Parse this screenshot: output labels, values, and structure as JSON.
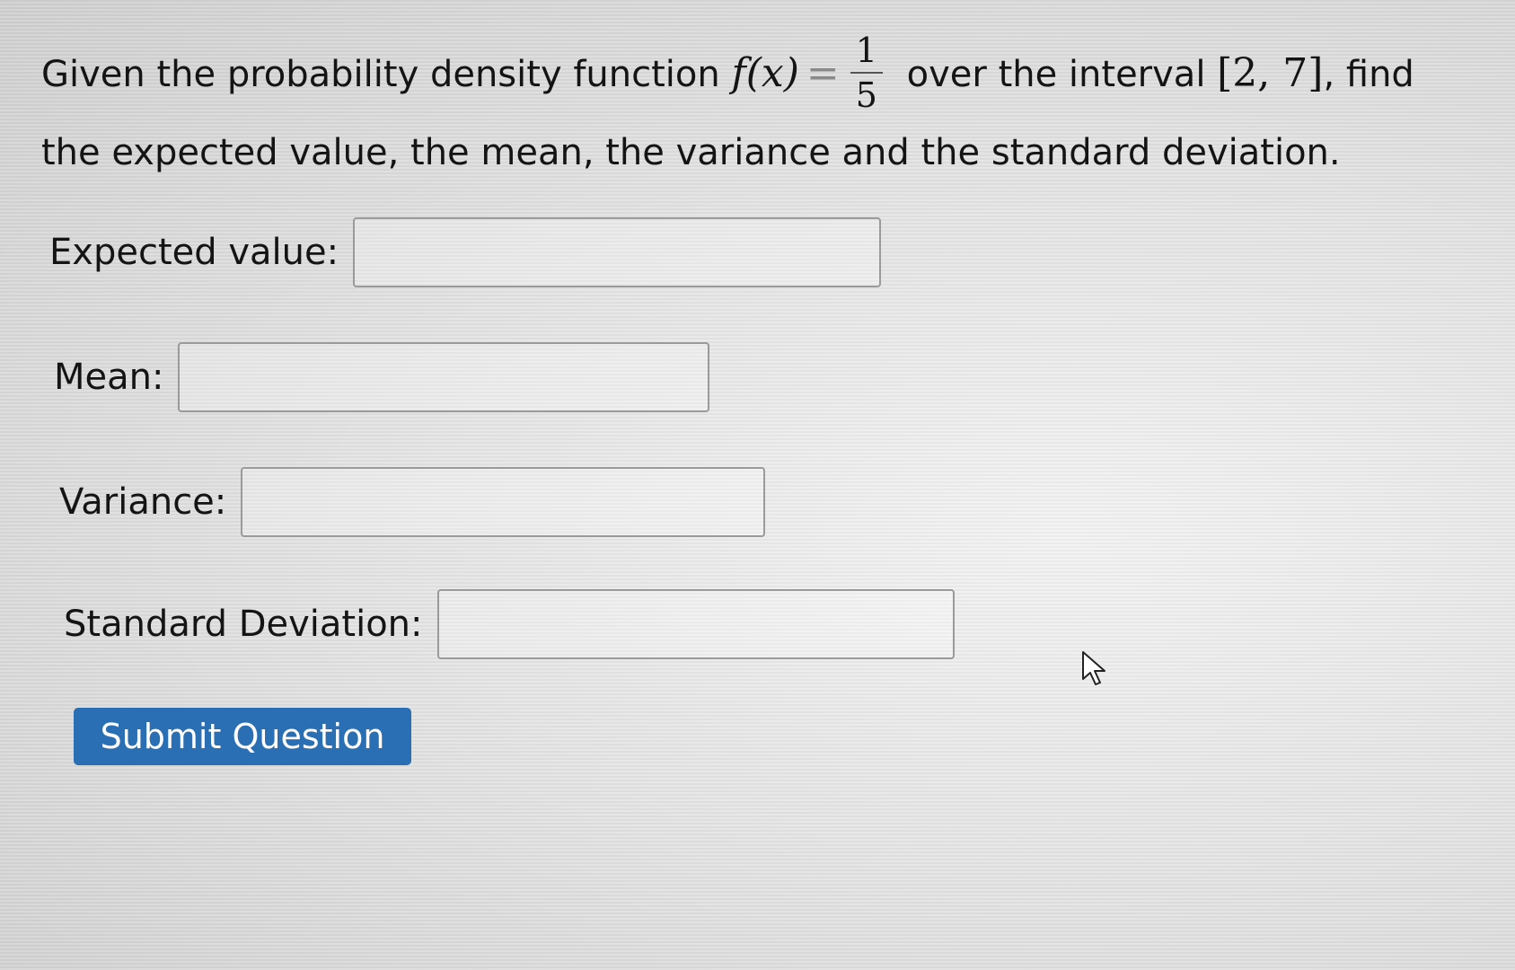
{
  "question": {
    "text_before": "Given the probability density function ",
    "math_fx": "f(x)",
    "math_eq": "=",
    "frac_num": "1",
    "frac_den": "5",
    "text_middle": " over the interval ",
    "interval": "[2, 7]",
    "text_after": ", find the expected value, the mean, the variance and the standard deviation."
  },
  "fields": {
    "expected_value": {
      "label": "Expected value:",
      "value": ""
    },
    "mean": {
      "label": "Mean:",
      "value": ""
    },
    "variance": {
      "label": "Variance:",
      "value": ""
    },
    "standard_deviation": {
      "label": "Standard Deviation:",
      "value": ""
    }
  },
  "submit": {
    "label": "Submit Question"
  },
  "icons": {
    "cursor": "mouse-pointer-icon"
  }
}
